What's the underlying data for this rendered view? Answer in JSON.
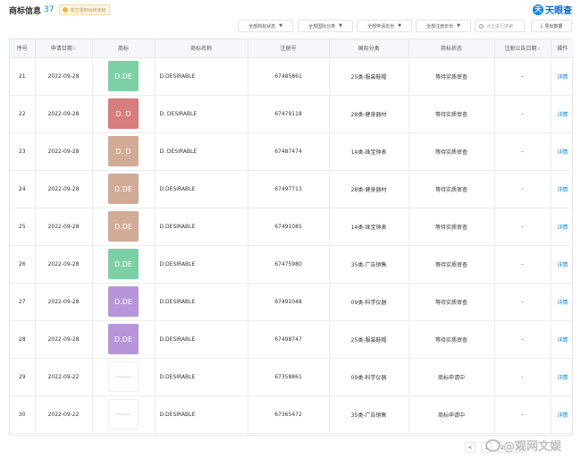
{
  "header": {
    "title": "商标信息",
    "count": "37",
    "notice": "发生侵权纠纷如何"
  },
  "brand": {
    "logo_char": "天",
    "name": "天眼查"
  },
  "filters": [
    {
      "label": "全部商标状态"
    },
    {
      "label": "全部国际分类"
    },
    {
      "label": "全部申请年份"
    },
    {
      "label": "全部注册年份"
    }
  ],
  "search": {
    "placeholder": "点击进行搜索"
  },
  "export": {
    "label": "导出数据"
  },
  "table": {
    "headers": [
      "序号",
      "申请日期",
      "商标",
      "商标名称",
      "注册号",
      "国际分类",
      "商标状态",
      "注册公告日期",
      "操作"
    ],
    "sort_glyph": "⇕",
    "rows": [
      {
        "no": "21",
        "date": "2022-09-28",
        "logo": "D.DE",
        "logo_color": "#7dd0a6",
        "name": "D.DESIRABLE",
        "reg": "67485861",
        "cls": "25类-服装鞋帽",
        "status": "等待实质审查",
        "pub": "-",
        "op": "详情"
      },
      {
        "no": "22",
        "date": "2022-09-28",
        "logo": "D. D",
        "logo_color": "#d67d7d",
        "name": "D. DESIRABLE",
        "reg": "67479118",
        "cls": "28类-健身器材",
        "status": "等待实质审查",
        "pub": "-",
        "op": "详情"
      },
      {
        "no": "23",
        "date": "2022-09-28",
        "logo": "D. D",
        "logo_color": "#d1ab96",
        "name": "D. DESIRABLE",
        "reg": "67487474",
        "cls": "14类-珠宝钟表",
        "status": "等待实质审查",
        "pub": "-",
        "op": "详情"
      },
      {
        "no": "24",
        "date": "2022-09-28",
        "logo": "D.DE",
        "logo_color": "#d1ab96",
        "name": "D.DESIRABLE",
        "reg": "67497713",
        "cls": "28类-健身器材",
        "status": "等待实质审查",
        "pub": "-",
        "op": "详情"
      },
      {
        "no": "25",
        "date": "2022-09-28",
        "logo": "D.DE",
        "logo_color": "#d1ab96",
        "name": "D.DESIRABLE",
        "reg": "67491085",
        "cls": "14类-珠宝钟表",
        "status": "等待实质审查",
        "pub": "-",
        "op": "详情"
      },
      {
        "no": "26",
        "date": "2022-09-28",
        "logo": "D.DE",
        "logo_color": "#7dd0a6",
        "name": "D.DESIRABLE",
        "reg": "67475980",
        "cls": "35类-广告销售",
        "status": "等待实质审查",
        "pub": "-",
        "op": "详情"
      },
      {
        "no": "27",
        "date": "2022-09-28",
        "logo": "D.DE",
        "logo_color": "#b695d8",
        "name": "D.DESIRABLE",
        "reg": "67491048",
        "cls": "09类-科学仪器",
        "status": "等待实质审查",
        "pub": "-",
        "op": "详情"
      },
      {
        "no": "28",
        "date": "2022-09-28",
        "logo": "D.DE",
        "logo_color": "#b695d8",
        "name": "D.DESIRABLE",
        "reg": "67498747",
        "cls": "25类-服装鞋帽",
        "status": "等待实质审查",
        "pub": "-",
        "op": "详情"
      },
      {
        "no": "29",
        "date": "2022-09-22",
        "logo": "D.Desirable",
        "logo_color": "",
        "name": "D.DESIRABLE",
        "reg": "67358861",
        "cls": "09类-科学仪器",
        "status": "商标申请中",
        "pub": "-",
        "op": "详情"
      },
      {
        "no": "30",
        "date": "2022-09-22",
        "logo": "D.Desirable",
        "logo_color": "",
        "name": "D.DESIRABLE",
        "reg": "67365472",
        "cls": "35类-广告销售",
        "status": "商标申请中",
        "pub": "-",
        "op": "详情"
      }
    ]
  },
  "pager": [
    "<",
    "1",
    "2",
    ">"
  ],
  "watermark": "@观网文娱"
}
